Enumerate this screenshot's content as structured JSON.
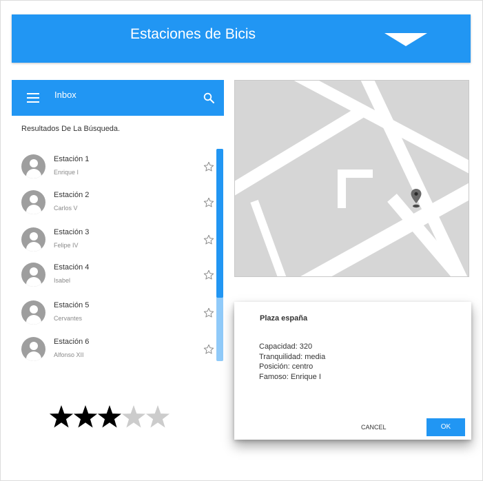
{
  "header": {
    "title": "Estaciones de Bicis"
  },
  "inbox": {
    "title": "Inbox"
  },
  "results_label": "Resultados De La Búsqueda.",
  "stations": [
    {
      "title": "Estación 1",
      "subtitle": "Enrique I"
    },
    {
      "title": "Estación 2",
      "subtitle": "Carlos V"
    },
    {
      "title": "Estación 3",
      "subtitle": "Felipe IV"
    },
    {
      "title": "Estación 4",
      "subtitle": "Isabel"
    },
    {
      "title": "Estación 5",
      "subtitle": "Cervantes"
    },
    {
      "title": "Estación 6",
      "subtitle": "Alfonso XII"
    }
  ],
  "rating": {
    "value": 3,
    "max": 5
  },
  "dialog": {
    "title": "Plaza españa",
    "lines": [
      "Capacidad: 320",
      "Tranquilidad: media",
      "Posición: centro",
      "Famoso: Enrique I"
    ],
    "cancel_label": "CANCEL",
    "ok_label": "OK"
  },
  "colors": {
    "primary": "#2196f3",
    "scrollbar_track": "#90caf9",
    "avatar": "#9e9e9e",
    "star_filled": "#000000",
    "star_empty": "#cccccc",
    "map_background": "#d6d6d6",
    "map_road": "#ffffff"
  },
  "icons": {
    "menu": "menu-icon",
    "search": "search-icon",
    "avatar": "person-icon",
    "favorite": "star-outline-icon",
    "marker": "map-pin-icon",
    "dropdown": "triangle-down-icon"
  }
}
